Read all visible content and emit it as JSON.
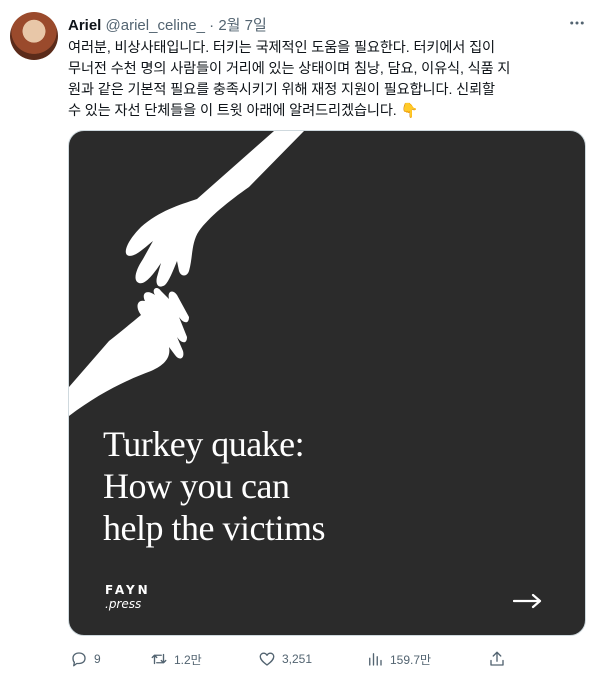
{
  "tweet": {
    "author_name": "Ariel",
    "handle": "@ariel_celine_",
    "separator": "·",
    "date": "2월 7일",
    "text_lines": [
      "여러분, 비상사태입니다. 터키는 국제적인 도움을 필요한다. 터키에서 집이",
      "무너전 수천 명의 사람들이 거리에 있는 상태이며 침낭, 담요, 이유식, 식품 지",
      "원과 같은 기본적 필요를 충족시키기 위해 재정 지원이 필요합니다. 신뢰할",
      "수 있는 자선 단체들을 이 트윗 아래에 알려드리겠습니다. 👇"
    ]
  },
  "media": {
    "headline_lines": [
      "Turkey quake:",
      "How you can",
      "help the victims"
    ],
    "brand_line1": "FAYN",
    "brand_line2": ".press",
    "background_color": "#2b2b2b"
  },
  "actions": {
    "replies": "9",
    "retweets": "1.2만",
    "likes": "3,251",
    "views": "159.7만"
  },
  "icons": {
    "more": "more-icon",
    "reply": "reply-icon",
    "retweet": "retweet-icon",
    "like": "heart-icon",
    "views": "views-icon",
    "share": "share-icon",
    "arrow": "arrow-right-icon"
  }
}
